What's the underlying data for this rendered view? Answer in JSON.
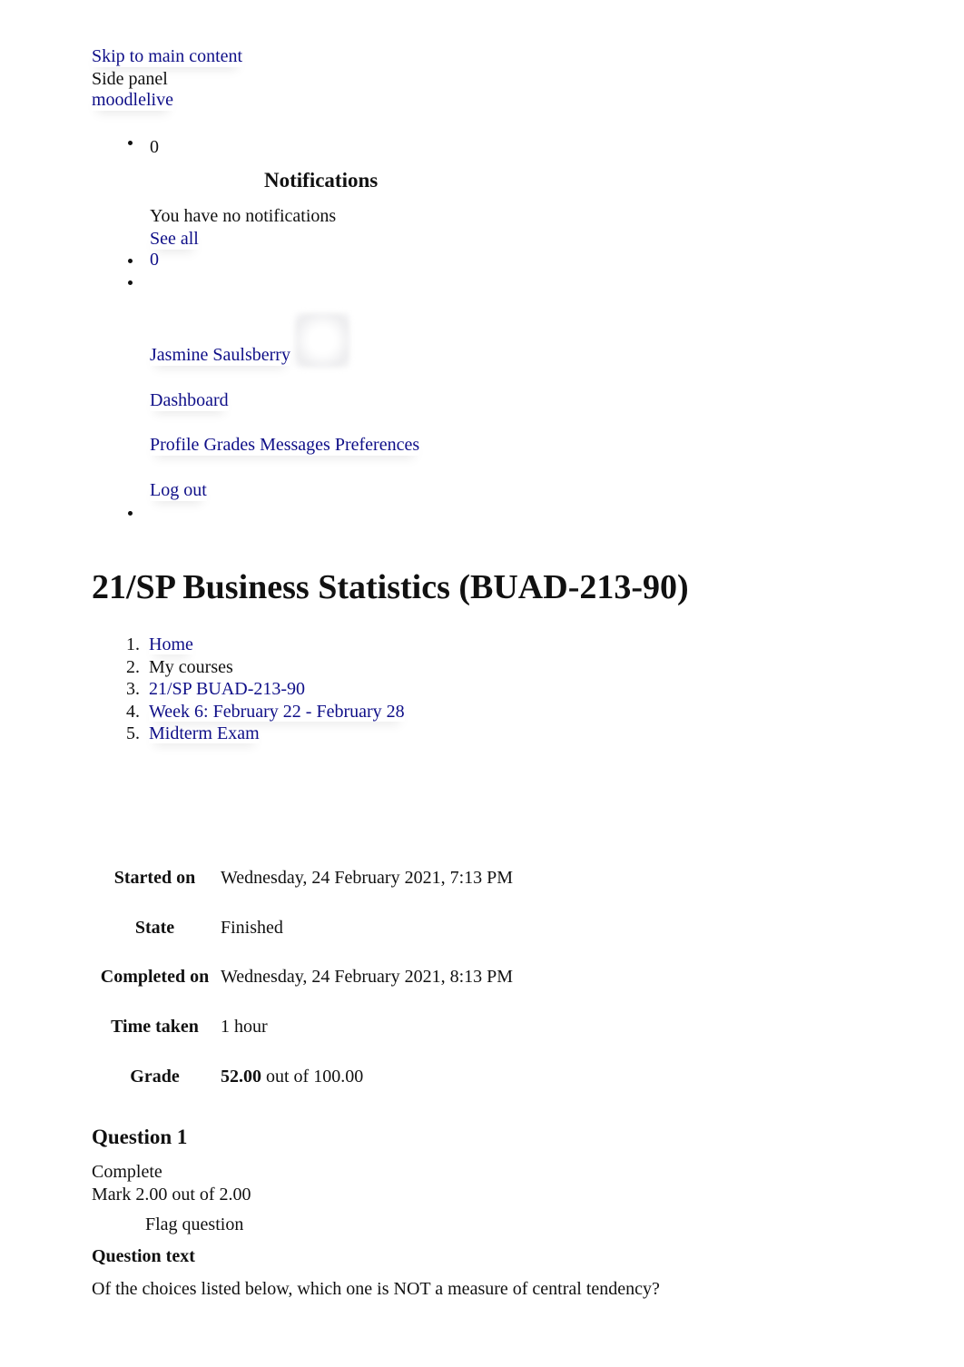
{
  "header": {
    "skip_link": "Skip to main content",
    "side_panel": "Side panel",
    "site_name": "moodlelive"
  },
  "notifications": {
    "count": "0",
    "title": "Notifications",
    "empty_message": "You have no notifications",
    "see_all": "See all"
  },
  "messages": {
    "count": "0"
  },
  "user_menu": {
    "user_name": "Jasmine Saulsberry",
    "avatar_icon": "user-avatar-placeholder",
    "dashboard": "Dashboard",
    "profile": "Profile",
    "grades": "Grades",
    "messages": "Messages",
    "preferences": "Preferences",
    "logout": "Log out"
  },
  "course": {
    "title": "21/SP Business Statistics (BUAD-213-90)"
  },
  "breadcrumb": [
    {
      "num": "1.",
      "label": "Home",
      "link": true
    },
    {
      "num": "2.",
      "label": "My courses",
      "link": false
    },
    {
      "num": "3.",
      "label": "21/SP BUAD-213-90",
      "link": true
    },
    {
      "num": "4.",
      "label": "Week 6: February 22 - February 28",
      "link": true
    },
    {
      "num": "5.",
      "label": "Midterm Exam",
      "link": true
    }
  ],
  "attempt_summary": {
    "started_on": {
      "label": "Started on",
      "value": "Wednesday, 24 February 2021, 7:13 PM"
    },
    "state": {
      "label": "State",
      "value": "Finished"
    },
    "completed_on": {
      "label": "Completed on",
      "value": "Wednesday, 24 February 2021, 8:13 PM"
    },
    "time_taken": {
      "label": "Time taken",
      "value": "1 hour"
    },
    "grade": {
      "label": "Grade",
      "score": "52.00",
      "rest": " out of 100.00"
    }
  },
  "question": {
    "heading": "Question 1",
    "status": "Complete",
    "mark": "Mark 2.00 out of 2.00",
    "flag": "Flag question",
    "text_heading": "Question text",
    "text": "Of the choices listed below, which one is NOT a measure of central tendency?"
  },
  "colors": {
    "link": "#0f0f88",
    "text": "#111111",
    "background": "#ffffff"
  }
}
